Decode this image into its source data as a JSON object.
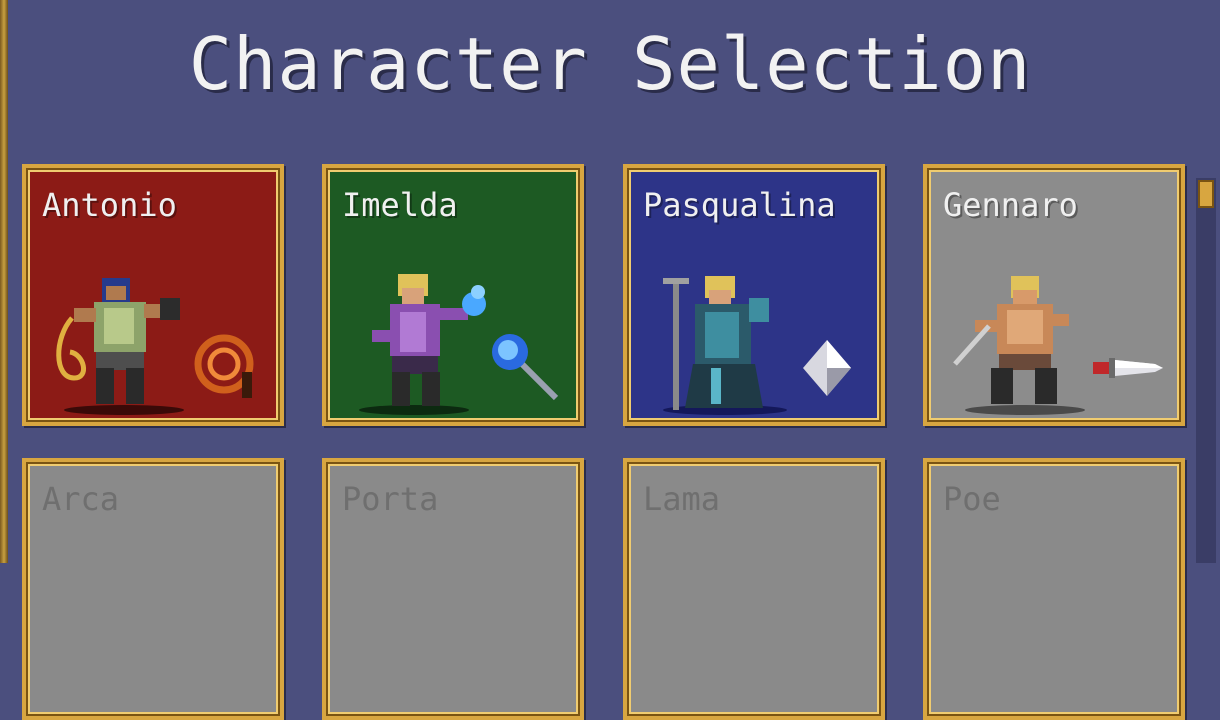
{
  "screen": {
    "title": "Character Selection"
  },
  "characters": [
    {
      "name": "Antonio",
      "color": "#8c1b16",
      "unlocked": true,
      "weapon_icon": "whip-icon"
    },
    {
      "name": "Imelda",
      "color": "#1d5a23",
      "unlocked": true,
      "weapon_icon": "magic-wand-icon"
    },
    {
      "name": "Pasqualina",
      "color": "#2d3488",
      "unlocked": true,
      "weapon_icon": "runetracer-icon"
    },
    {
      "name": "Gennaro",
      "color": "#8c8c8c",
      "unlocked": true,
      "weapon_icon": "knife-icon"
    },
    {
      "name": "Arca",
      "color": "#8a8a8a",
      "unlocked": false
    },
    {
      "name": "Porta",
      "color": "#8a8a8a",
      "unlocked": false
    },
    {
      "name": "Lama",
      "color": "#8a8a8a",
      "unlocked": false
    },
    {
      "name": "Poe",
      "color": "#8a8a8a",
      "unlocked": false
    }
  ],
  "colors": {
    "background": "#4b4f7e",
    "card_border": "#d8a640",
    "title_text": "#f2f2f2",
    "locked_text": "#6f6f6f"
  }
}
